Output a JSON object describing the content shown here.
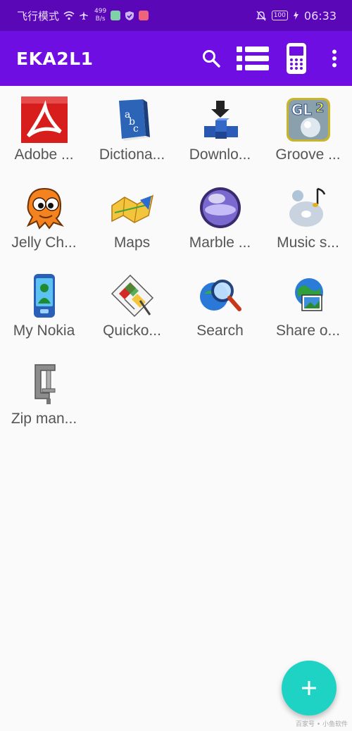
{
  "status_bar": {
    "carrier": "飞行模式",
    "speed_value": "499",
    "speed_unit": "B/s",
    "battery": "100",
    "time": "06:33"
  },
  "app_bar": {
    "title": "EKA2L1",
    "actions": [
      "search-icon",
      "list-icon",
      "phone-icon",
      "more-vert-icon"
    ]
  },
  "apps": [
    {
      "label": "Adobe ...",
      "icon": "adobe-reader-icon"
    },
    {
      "label": "Dictiona...",
      "icon": "dictionary-icon"
    },
    {
      "label": "Downlo...",
      "icon": "download-icon"
    },
    {
      "label": "Groove ...",
      "icon": "groove-gl2-icon"
    },
    {
      "label": "Jelly Ch...",
      "icon": "jelly-character-icon"
    },
    {
      "label": "Maps",
      "icon": "maps-icon"
    },
    {
      "label": "Marble ...",
      "icon": "marble-icon"
    },
    {
      "label": "Music s...",
      "icon": "music-icon"
    },
    {
      "label": "My Nokia",
      "icon": "my-nokia-icon"
    },
    {
      "label": "Quicko...",
      "icon": "quickoffice-icon"
    },
    {
      "label": "Search",
      "icon": "search-globe-icon"
    },
    {
      "label": "Share o...",
      "icon": "share-online-icon"
    },
    {
      "label": "Zip man...",
      "icon": "zip-manager-icon"
    }
  ],
  "fab": {
    "icon": "add-icon"
  },
  "watermark": "百家号 • 小鱼软件"
}
